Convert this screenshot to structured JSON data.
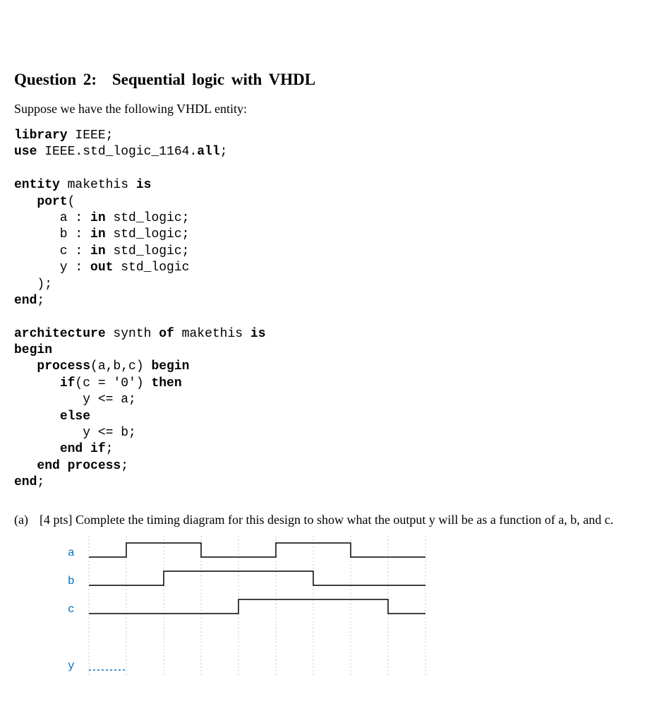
{
  "heading": {
    "number": "Question 2:",
    "title": "Sequential logic with VHDL"
  },
  "lead": "Suppose we have the following VHDL entity:",
  "code": {
    "line1_kw": "library",
    "line1_rest": " IEEE;",
    "line2_kw1": "use",
    "line2_mid": " IEEE.std_logic_1164.",
    "line2_kw2": "all",
    "line2_end": ";",
    "line3_kw1": "entity",
    "line3_mid": " makethis ",
    "line3_kw2": "is",
    "line4_kw": "port",
    "line4_rest": "(",
    "line5_pre": "      a : ",
    "line5_kw": "in",
    "line5_post": " std_logic;",
    "line6_pre": "      b : ",
    "line6_kw": "in",
    "line6_post": " std_logic;",
    "line7_pre": "      c : ",
    "line7_kw": "in",
    "line7_post": " std_logic;",
    "line8_pre": "      y : ",
    "line8_kw": "out",
    "line8_post": " std_logic",
    "line9": "   );",
    "line10_kw": "end",
    "line10_rest": ";",
    "line11_kw1": "architecture",
    "line11_mid1": " synth ",
    "line11_kw2": "of",
    "line11_mid2": " makethis ",
    "line11_kw3": "is",
    "line12_kw": "begin",
    "line13_kw1": "process",
    "line13_mid": "(a,b,c) ",
    "line13_kw2": "begin",
    "line14_kw1": "if",
    "line14_mid": "(c = '0') ",
    "line14_kw2": "then",
    "line15": "         y <= a;",
    "line16_kw": "else",
    "line17": "         y <= b;",
    "line18_kw": "end if",
    "line18_rest": ";",
    "line19_kw": "end process",
    "line19_rest": ";",
    "line20_kw": "end",
    "line20_rest": ";"
  },
  "part_a": {
    "label": "(a)",
    "points": "[4 pts]",
    "text": "Complete the timing diagram for this design to show what the output y will be as a function of a, b, and c."
  },
  "timing": {
    "signals": [
      "a",
      "b",
      "c",
      "y"
    ],
    "gridDivisions": 9,
    "colors": {
      "label": "#0070c0"
    }
  }
}
